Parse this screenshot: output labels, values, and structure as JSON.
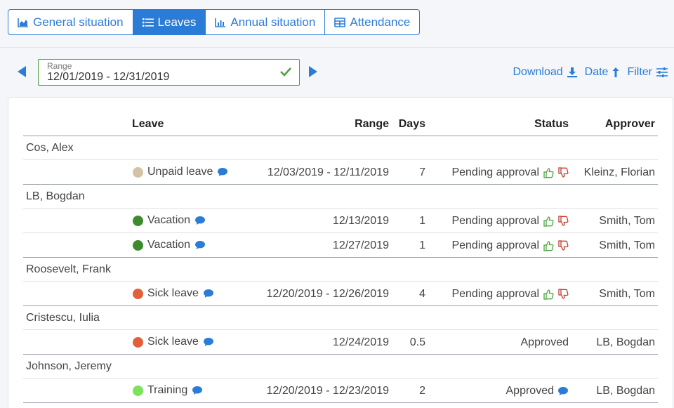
{
  "tabs": [
    {
      "label": "General situation",
      "icon": "area-chart-icon",
      "active": false
    },
    {
      "label": "Leaves",
      "icon": "list-icon",
      "active": true
    },
    {
      "label": "Annual situation",
      "icon": "bar-chart-icon",
      "active": false
    },
    {
      "label": "Attendance",
      "icon": "table-icon",
      "active": false
    }
  ],
  "range": {
    "label": "Range",
    "value": "12/01/2019 - 12/31/2019"
  },
  "toolbar": {
    "download": "Download",
    "date": "Date",
    "filter": "Filter"
  },
  "table": {
    "headers": {
      "leave": "Leave",
      "range": "Range",
      "days": "Days",
      "status": "Status",
      "approver": "Approver"
    },
    "groups": [
      {
        "name": "Cos, Alex",
        "rows": [
          {
            "leave": "Unpaid leave",
            "color": "#d2c3a6",
            "range": "12/03/2019 - 12/11/2019",
            "days": "7",
            "status": "Pending approval",
            "approver": "Kleinz, Florian"
          }
        ]
      },
      {
        "name": "LB, Bogdan",
        "rows": [
          {
            "leave": "Vacation",
            "color": "#3e8b2e",
            "range": "12/13/2019",
            "days": "1",
            "status": "Pending approval",
            "approver": "Smith, Tom"
          },
          {
            "leave": "Vacation",
            "color": "#3e8b2e",
            "range": "12/27/2019",
            "days": "1",
            "status": "Pending approval",
            "approver": "Smith, Tom"
          }
        ]
      },
      {
        "name": "Roosevelt, Frank",
        "rows": [
          {
            "leave": "Sick leave",
            "color": "#e4603c",
            "range": "12/20/2019 - 12/26/2019",
            "days": "4",
            "status": "Pending approval",
            "approver": "Smith, Tom"
          }
        ]
      },
      {
        "name": "Cristescu, Iulia",
        "rows": [
          {
            "leave": "Sick leave",
            "color": "#e4603c",
            "range": "12/24/2019",
            "days": "0.5",
            "status": "Approved",
            "approver": "LB, Bogdan"
          }
        ]
      },
      {
        "name": "Johnson, Jeremy",
        "rows": [
          {
            "leave": "Training",
            "color": "#7be35a",
            "range": "12/20/2019 - 12/23/2019",
            "days": "2",
            "status": "Approved",
            "approver": "LB, Bogdan",
            "status_comment": true
          }
        ]
      }
    ]
  },
  "colors": {
    "accent": "#2a7cd6",
    "approve": "#4aa33f",
    "reject": "#c0392b"
  }
}
